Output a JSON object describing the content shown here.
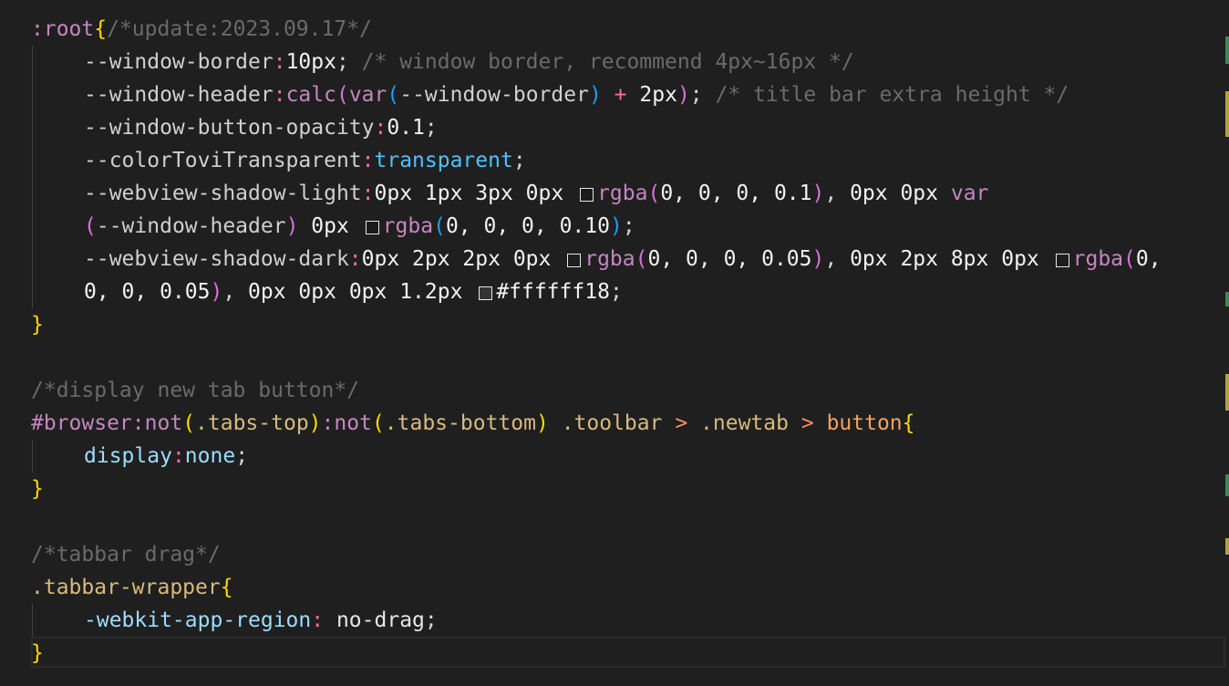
{
  "editor": {
    "top_comment": "/*update:2023.09.17*/",
    "root_selector": ":root",
    "open_brace": "{",
    "close_brace": "}",
    "vars": {
      "window_border": {
        "name": "--window-border",
        "value": "10px",
        "comment": "/* window border, recommend 4px~16px */"
      },
      "window_header": {
        "name": "--window-header",
        "fn_calc": "calc",
        "fn_var": "var",
        "arg": "--window-border",
        "plus": "+",
        "addend": "2px",
        "comment": "/* title bar extra height */"
      },
      "window_button_opacity": {
        "name": "--window-button-opacity",
        "value": "0.1"
      },
      "color_tovi": {
        "name": "--colorToviTransparent",
        "value": "transparent"
      },
      "shadow_light": {
        "name": "--webview-shadow-light",
        "offsets_1": "0px 1px 3px 0px",
        "rgba_fn": "rgba",
        "rgba_args_1": "0, 0, 0, 0.1",
        "offsets_2": "0px 0px",
        "var_fn": "var",
        "var_arg": "--window-header",
        "offsets_3": "0px",
        "rgba_args_2": "0, 0, 0, 0.10"
      },
      "shadow_dark": {
        "name": "--webview-shadow-dark",
        "offsets_1": "0px 2px 2px 0px",
        "rgba_fn": "rgba",
        "rgba_args_1": "0, 0, 0, 0.05",
        "offsets_2": "0px 2px 8px 0px",
        "rgba_args_2_a": "0,",
        "rgba_args_2_b": "0, 0, 0.05",
        "offsets_3": "0px 0px 0px 1.2px",
        "hex_value": "#ffffff18"
      }
    },
    "comment_newtab": "/*display new tab button*/",
    "newtab_rule": {
      "id": "#browser",
      "pseudo_not": "not",
      "class_tabs_top": ".tabs-top",
      "class_tabs_bottom": ".tabs-bottom",
      "class_toolbar": ".toolbar",
      "combinator": ">",
      "class_newtab": ".newtab",
      "tag_button": "button",
      "prop": "display",
      "value": "none"
    },
    "comment_tabbar": "/*tabbar drag*/",
    "tabbar_rule": {
      "selector": ".tabbar-wrapper",
      "prop": "-webkit-app-region",
      "value": "no-drag"
    },
    "colors": {
      "background": "#1f1f1f",
      "comment": "#6a6a6a",
      "brace": "#ffd700",
      "property": "#9cdcfe",
      "function": "#c586c0"
    }
  }
}
